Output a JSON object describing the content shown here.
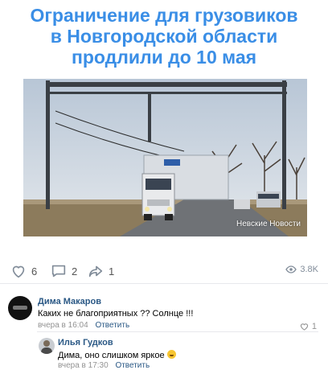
{
  "post": {
    "title_lines": [
      "Ограничение для грузовиков",
      "в Новгородской области",
      "продлили до 10 мая"
    ],
    "photo_watermark": "Невские Новости"
  },
  "actions": {
    "likes": "6",
    "comments": "2",
    "shares": "1",
    "views": "3.8K"
  },
  "comments": [
    {
      "author": "Дима Макаров",
      "text": "Каких не благоприятных ?? Солнце !!!",
      "time": "вчера в 16:04",
      "reply_label": "Ответить",
      "likes": "1"
    },
    {
      "author": "Илья Гудков",
      "text": "Дима, оно слишком яркое",
      "time": "вчера в 17:30",
      "reply_label": "Ответить"
    }
  ],
  "colors": {
    "title": "#3a8ee6",
    "link": "#2a5885",
    "meta": "#939393"
  }
}
